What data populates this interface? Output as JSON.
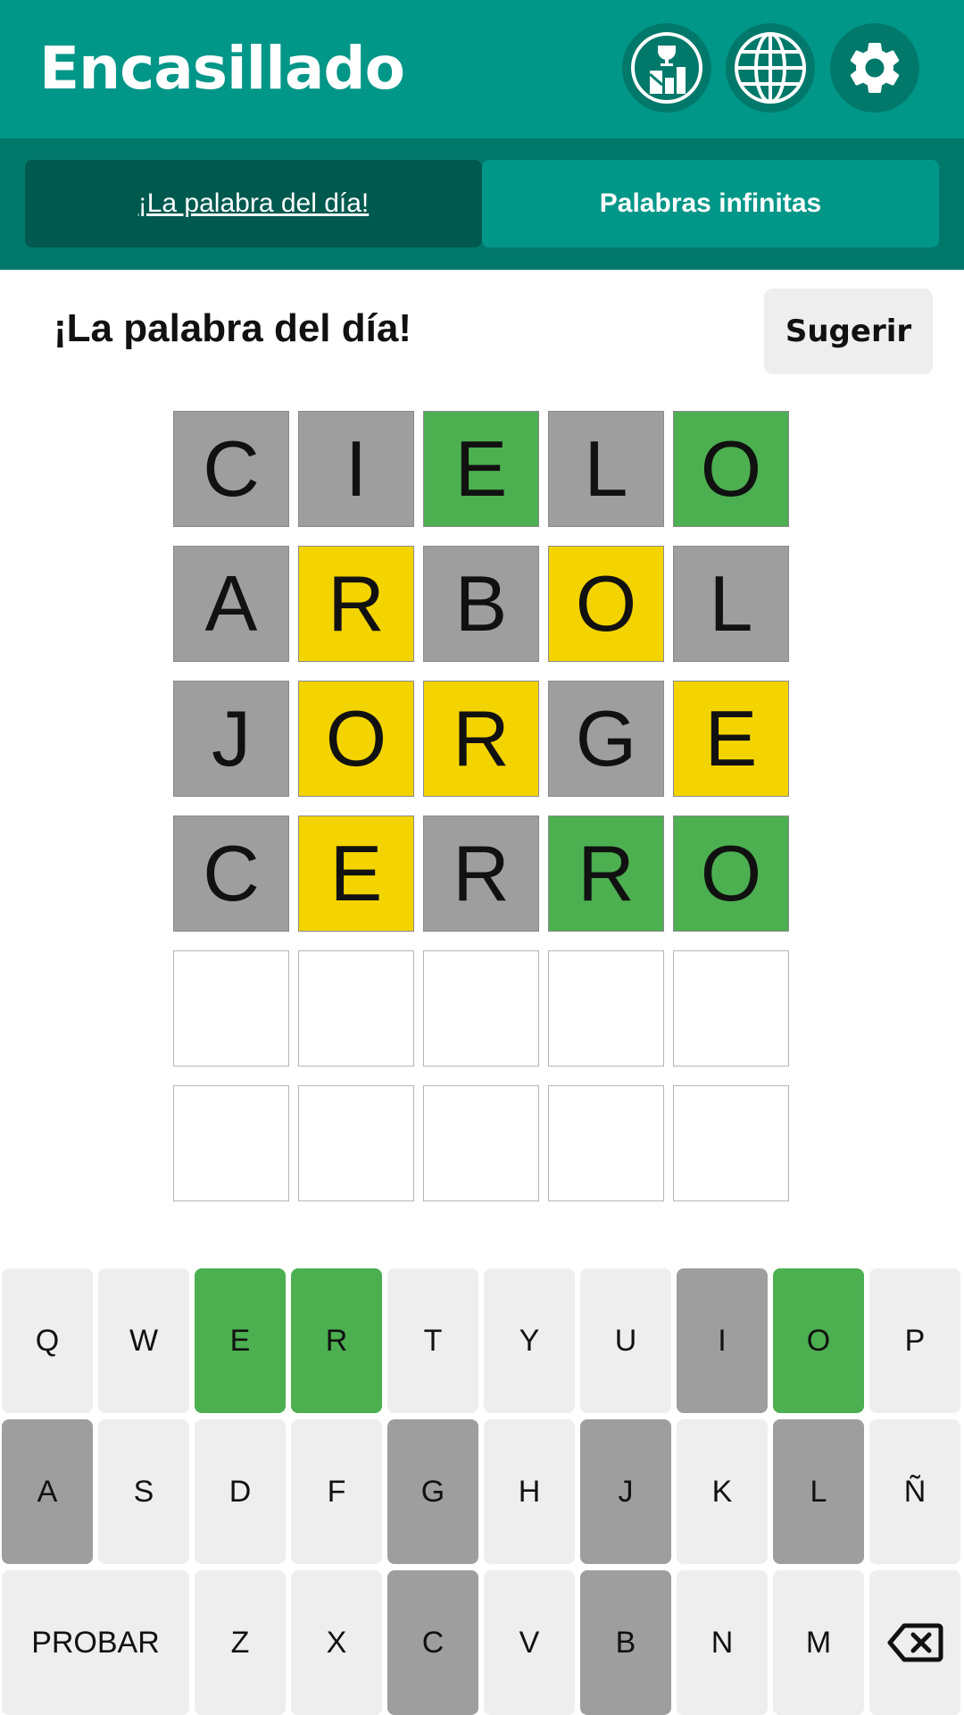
{
  "header": {
    "title": "Encasillado",
    "colors": {
      "primary": "#009688",
      "dark": "#00796b",
      "darker": "#00594f"
    },
    "icons": [
      "stats-icon",
      "globe-icon",
      "gear-icon"
    ]
  },
  "tabs": [
    {
      "label": "¡La palabra del día!",
      "active": true
    },
    {
      "label": "Palabras infinitas",
      "active": false
    }
  ],
  "subheader": {
    "title": "¡La palabra del día!",
    "suggest_label": "Sugerir"
  },
  "board": {
    "colors": {
      "gray": "#9e9e9e",
      "yellow": "#f4d400",
      "green": "#4caf50"
    },
    "rows": [
      [
        {
          "letter": "C",
          "state": "gray"
        },
        {
          "letter": "I",
          "state": "gray"
        },
        {
          "letter": "E",
          "state": "green"
        },
        {
          "letter": "L",
          "state": "gray"
        },
        {
          "letter": "O",
          "state": "green"
        }
      ],
      [
        {
          "letter": "A",
          "state": "gray"
        },
        {
          "letter": "R",
          "state": "yellow"
        },
        {
          "letter": "B",
          "state": "gray"
        },
        {
          "letter": "O",
          "state": "yellow"
        },
        {
          "letter": "L",
          "state": "gray"
        }
      ],
      [
        {
          "letter": "J",
          "state": "gray"
        },
        {
          "letter": "O",
          "state": "yellow"
        },
        {
          "letter": "R",
          "state": "yellow"
        },
        {
          "letter": "G",
          "state": "gray"
        },
        {
          "letter": "E",
          "state": "yellow"
        }
      ],
      [
        {
          "letter": "C",
          "state": "gray"
        },
        {
          "letter": "E",
          "state": "yellow"
        },
        {
          "letter": "R",
          "state": "gray"
        },
        {
          "letter": "R",
          "state": "green"
        },
        {
          "letter": "O",
          "state": "green"
        }
      ],
      [
        {
          "letter": "",
          "state": "empty"
        },
        {
          "letter": "",
          "state": "empty"
        },
        {
          "letter": "",
          "state": "empty"
        },
        {
          "letter": "",
          "state": "empty"
        },
        {
          "letter": "",
          "state": "empty"
        }
      ],
      [
        {
          "letter": "",
          "state": "empty"
        },
        {
          "letter": "",
          "state": "empty"
        },
        {
          "letter": "",
          "state": "empty"
        },
        {
          "letter": "",
          "state": "empty"
        },
        {
          "letter": "",
          "state": "empty"
        }
      ]
    ]
  },
  "keyboard": {
    "rows": [
      [
        {
          "label": "Q",
          "state": "default"
        },
        {
          "label": "W",
          "state": "default"
        },
        {
          "label": "E",
          "state": "green"
        },
        {
          "label": "R",
          "state": "green"
        },
        {
          "label": "T",
          "state": "default"
        },
        {
          "label": "Y",
          "state": "default"
        },
        {
          "label": "U",
          "state": "default"
        },
        {
          "label": "I",
          "state": "gray"
        },
        {
          "label": "O",
          "state": "green"
        },
        {
          "label": "P",
          "state": "default"
        }
      ],
      [
        {
          "label": "A",
          "state": "gray"
        },
        {
          "label": "S",
          "state": "default"
        },
        {
          "label": "D",
          "state": "default"
        },
        {
          "label": "F",
          "state": "default"
        },
        {
          "label": "G",
          "state": "gray"
        },
        {
          "label": "H",
          "state": "default"
        },
        {
          "label": "J",
          "state": "gray"
        },
        {
          "label": "K",
          "state": "default"
        },
        {
          "label": "L",
          "state": "gray"
        },
        {
          "label": "Ñ",
          "state": "default"
        }
      ],
      [
        {
          "label": "PROBAR",
          "state": "default",
          "wide": true
        },
        {
          "label": "Z",
          "state": "default"
        },
        {
          "label": "X",
          "state": "default"
        },
        {
          "label": "C",
          "state": "gray"
        },
        {
          "label": "V",
          "state": "default"
        },
        {
          "label": "B",
          "state": "gray"
        },
        {
          "label": "N",
          "state": "default"
        },
        {
          "label": "M",
          "state": "default"
        },
        {
          "label": "",
          "state": "default",
          "icon": "backspace-icon"
        }
      ]
    ]
  }
}
